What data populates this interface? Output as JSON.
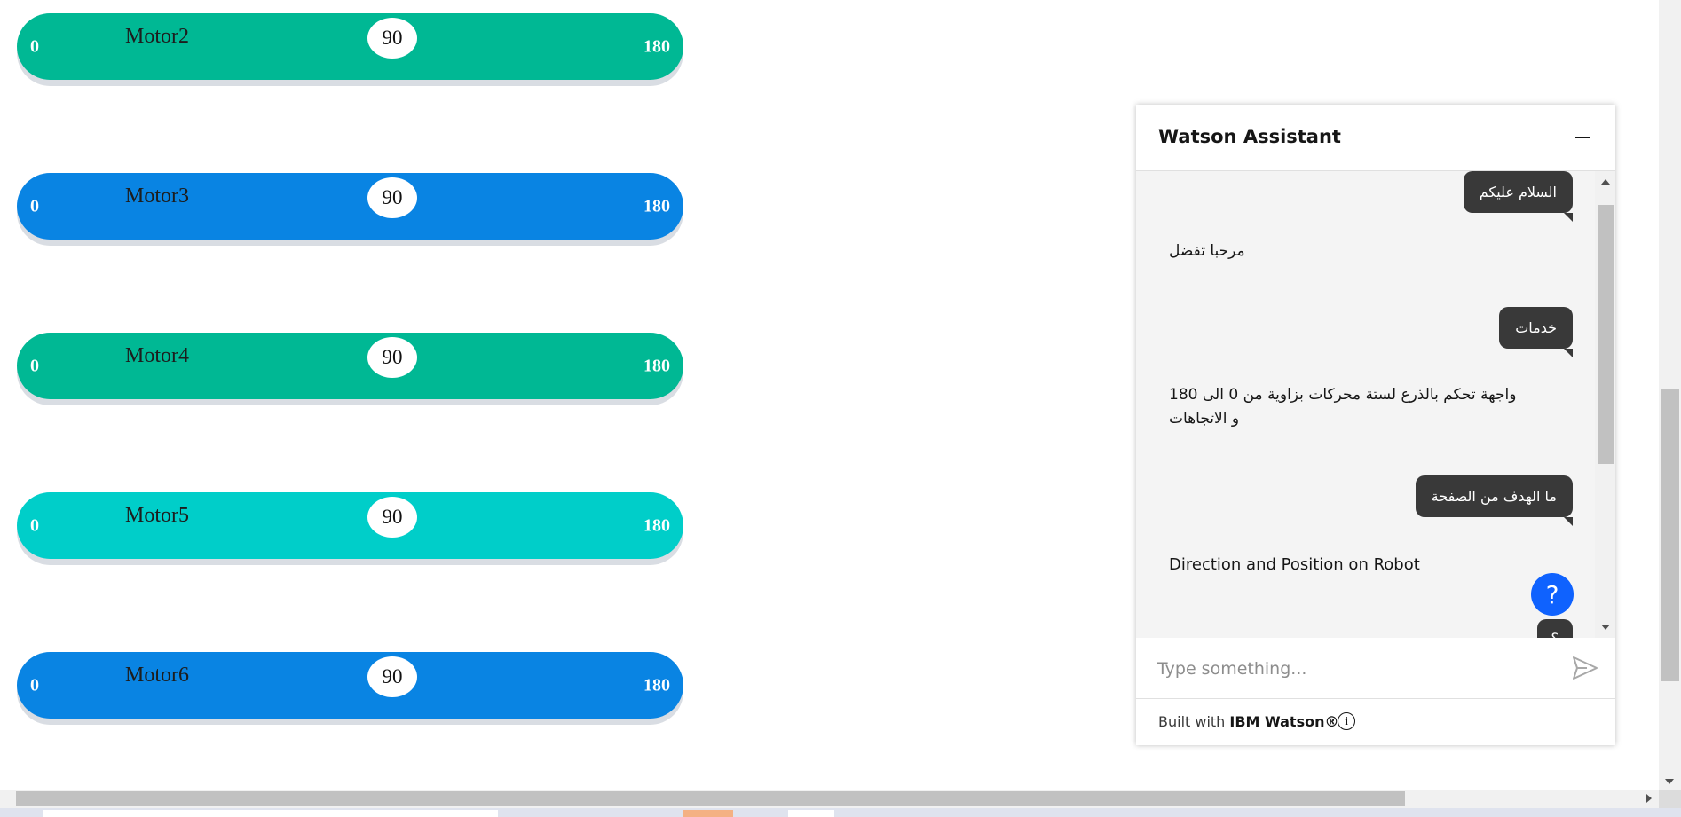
{
  "motors": [
    {
      "name": "Motor2",
      "min": "0",
      "max": "180",
      "value": "90",
      "color": "#00b894"
    },
    {
      "name": "Motor3",
      "min": "0",
      "max": "180",
      "value": "90",
      "color": "#0984e3"
    },
    {
      "name": "Motor4",
      "min": "0",
      "max": "180",
      "value": "90",
      "color": "#00b894"
    },
    {
      "name": "Motor5",
      "min": "0",
      "max": "180",
      "value": "90",
      "color": "#00cec9"
    },
    {
      "name": "Motor6",
      "min": "0",
      "max": "180",
      "value": "90",
      "color": "#0984e3"
    }
  ],
  "assistant": {
    "title": "Watson Assistant",
    "messages": [
      {
        "from": "user",
        "text": "السلام عليكم"
      },
      {
        "from": "bot",
        "text": "مرحبا تفضل"
      },
      {
        "from": "user",
        "text": "خدمات"
      },
      {
        "from": "bot",
        "text": "واجهة تحكم بالذرع لستة محركات بزاوية من 0 الى 180 و الاتجاهات"
      },
      {
        "from": "user",
        "text": "ما الهدف من الصفحة"
      },
      {
        "from": "bot",
        "text": "Direction and Position on Robot"
      },
      {
        "from": "user",
        "text": "؟"
      }
    ],
    "input_placeholder": "Type something...",
    "footer_prefix": "Built with ",
    "footer_brand": "IBM Watson®",
    "help_label": "?",
    "info_label": "i"
  },
  "colors": {
    "accent": "#0f62fe",
    "bubble": "#393939"
  }
}
